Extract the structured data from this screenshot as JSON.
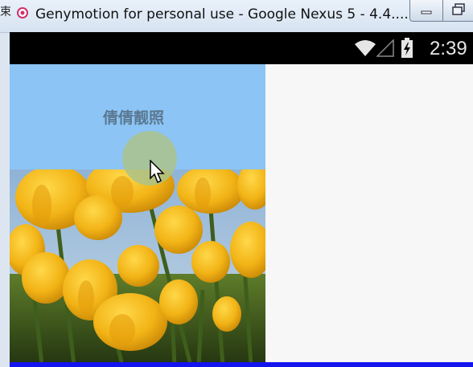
{
  "window": {
    "edge_char": "束",
    "title": "Genymotion for personal use - Google Nexus 5 - 4.4...."
  },
  "status_bar": {
    "time": "2:39",
    "icons": [
      "wifi-icon",
      "signal-icon",
      "battery-icon"
    ]
  },
  "header": {
    "title": "倩倩靓照",
    "background": "#8cc4f5"
  },
  "photo": {
    "subject": "yellow tulips"
  },
  "colors": {
    "status_bar": "#000000",
    "bottom_line": "#1414ee",
    "right_panel": "#f7f7f7"
  }
}
